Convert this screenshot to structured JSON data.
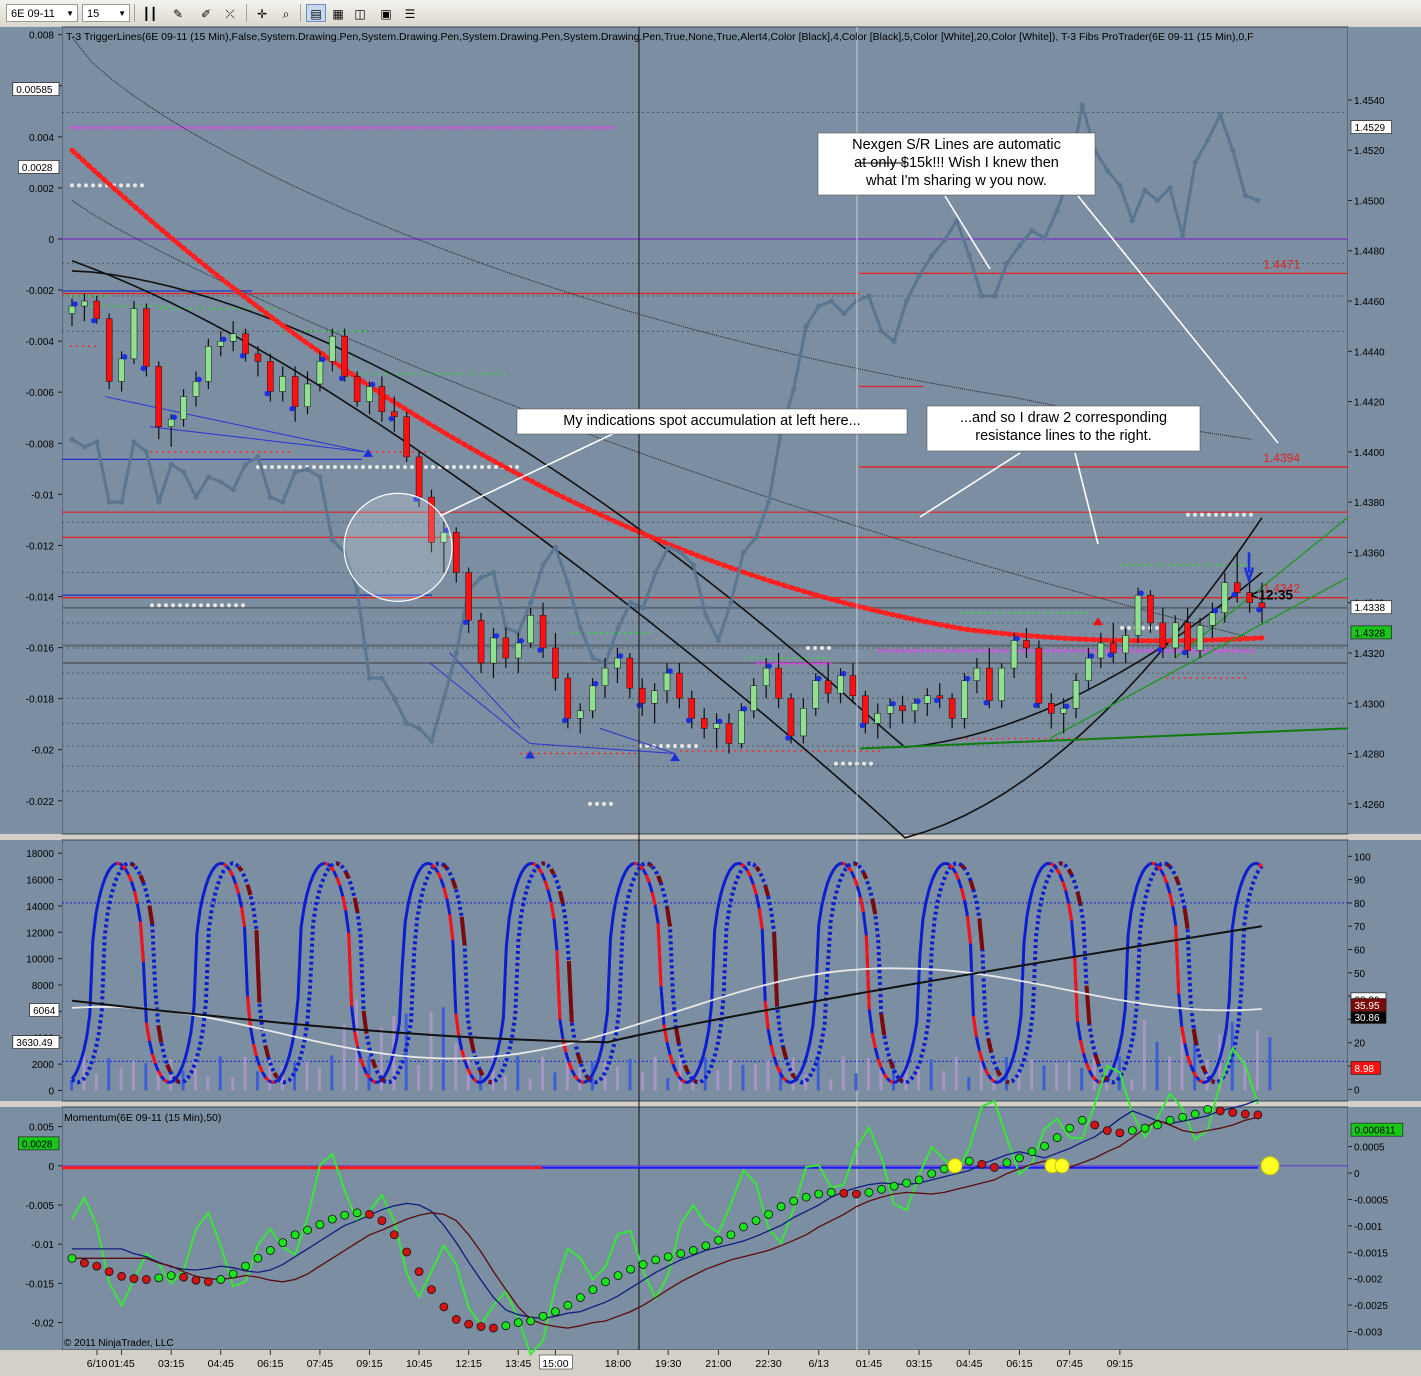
{
  "toolbar": {
    "instrument": "6E 09-11",
    "interval": "15 Min",
    "icons": [
      "bar-style-icon",
      "draw-pen-icon",
      "crosshair-icon",
      "zoom-icon",
      "properties-icon",
      "indicators-icon",
      "strategies-icon",
      "data-box-icon"
    ]
  },
  "colors": {
    "plot_bg": "#7c8ea1",
    "up_bar": "#8fe08f",
    "down_bar": "#ff1010",
    "ma_red": "#ff2020",
    "price_line": "#5a7690",
    "resistance": "#e32020",
    "magenta": "#ff33ff",
    "stoch_blue": "#0b1fd0",
    "stoch_cyan": "#22e6f5",
    "stoch_darkred": "#7b0a0a"
  },
  "chart_data": [
    {
      "panel": "price",
      "type": "candlestick",
      "header": "T-3 TriggerLines(6E 09-11 (15 Min),False,System.Drawing.Pen,System.Drawing.Pen,System.Drawing.Pen,System.Drawing.Pen,True,None,True,Alert4,Color [Black],4,Color [Black],5,Color [White],20,Color [White]), T-3 Fibs ProTrader(6E 09-11 (15 Min),0,F",
      "left_axis": {
        "range": [
          -0.0233,
          0.0083
        ],
        "ticks": [
          0.008,
          0.006,
          0.004,
          0.002,
          0,
          -0.002,
          -0.004,
          -0.006,
          -0.008,
          -0.01,
          -0.012,
          -0.014,
          -0.016,
          -0.018,
          -0.02,
          -0.022
        ],
        "labels": [
          "0.008",
          "0.006",
          "0.004",
          "0.002",
          "0",
          "-0.002",
          "-0.004",
          "-0.006",
          "-0.008",
          "-0.01",
          "-0.012",
          "-0.014",
          "-0.016",
          "-0.018",
          "-0.02",
          "-0.022"
        ]
      },
      "right_axis": {
        "range": [
          1.4248,
          1.4569
        ],
        "ticks": [
          1.454,
          1.452,
          1.45,
          1.448,
          1.446,
          1.444,
          1.442,
          1.44,
          1.438,
          1.436,
          1.434,
          1.432,
          1.43,
          1.428,
          1.426
        ],
        "labels": [
          "1.4540",
          "1.4520",
          "1.4500",
          "1.4480",
          "1.4460",
          "1.4440",
          "1.4420",
          "1.4400",
          "1.4380",
          "1.4360",
          "1.4340",
          "1.4320",
          "1.4300",
          "1.4280",
          "1.4260"
        ]
      },
      "markers_left": [
        {
          "value": 0.00585,
          "label": "0.00585"
        },
        {
          "value": 0.0028,
          "label": "0.0028"
        }
      ],
      "markers_right": [
        {
          "value": 1.4529,
          "label": "1.4529",
          "style": "white"
        },
        {
          "value": 1.4338,
          "label": "1.4338",
          "style": "white"
        },
        {
          "value": 1.4328,
          "label": "1.4328",
          "style": "green"
        }
      ],
      "time_remaining": "<12:35",
      "levels": [
        {
          "value": 1.4471,
          "label": "1.4471",
          "from": 0.62,
          "to": 1.0
        },
        {
          "value": 1.4394,
          "label": "1.4394",
          "from": 0.62,
          "to": 1.0
        },
        {
          "value": 1.4342,
          "label": "1.4342",
          "from": 0.0,
          "to": 1.0
        }
      ],
      "candles": [
        [
          1.4455,
          1.4461,
          1.445,
          1.4458
        ],
        [
          1.4458,
          1.4463,
          1.4452,
          1.446
        ],
        [
          1.446,
          1.4462,
          1.4451,
          1.4453
        ],
        [
          1.4453,
          1.4455,
          1.4425,
          1.4428
        ],
        [
          1.4428,
          1.444,
          1.4424,
          1.4437
        ],
        [
          1.4437,
          1.446,
          1.4435,
          1.4457
        ],
        [
          1.4457,
          1.4459,
          1.443,
          1.4434
        ],
        [
          1.4434,
          1.4436,
          1.4405,
          1.441
        ],
        [
          1.441,
          1.4415,
          1.4402,
          1.4413
        ],
        [
          1.4413,
          1.4425,
          1.441,
          1.4422
        ],
        [
          1.4422,
          1.4432,
          1.4418,
          1.4428
        ],
        [
          1.4428,
          1.4445,
          1.4425,
          1.4442
        ],
        [
          1.4442,
          1.4448,
          1.4438,
          1.4444
        ],
        [
          1.4444,
          1.4452,
          1.444,
          1.4447
        ],
        [
          1.4447,
          1.4449,
          1.4436,
          1.4439
        ],
        [
          1.4439,
          1.4442,
          1.443,
          1.4436
        ],
        [
          1.4436,
          1.4439,
          1.442,
          1.4424
        ],
        [
          1.4424,
          1.4434,
          1.442,
          1.443
        ],
        [
          1.443,
          1.4434,
          1.4412,
          1.4418
        ],
        [
          1.4418,
          1.4432,
          1.4415,
          1.4427
        ],
        [
          1.4427,
          1.444,
          1.4424,
          1.4436
        ],
        [
          1.4436,
          1.4449,
          1.4432,
          1.4446
        ],
        [
          1.4446,
          1.4449,
          1.4428,
          1.443
        ],
        [
          1.443,
          1.4432,
          1.4418,
          1.442
        ],
        [
          1.442,
          1.4428,
          1.4415,
          1.4426
        ],
        [
          1.4426,
          1.443,
          1.4412,
          1.4416
        ],
        [
          1.4416,
          1.4422,
          1.4408,
          1.4414
        ],
        [
          1.4414,
          1.4416,
          1.4396,
          1.4398
        ],
        [
          1.4398,
          1.44,
          1.4378,
          1.4382
        ],
        [
          1.4382,
          1.4385,
          1.436,
          1.4364
        ],
        [
          1.4364,
          1.4372,
          1.4352,
          1.4368
        ],
        [
          1.4368,
          1.437,
          1.4348,
          1.4352
        ],
        [
          1.4352,
          1.4354,
          1.4328,
          1.4333
        ],
        [
          1.4333,
          1.4336,
          1.4312,
          1.4316
        ],
        [
          1.4316,
          1.433,
          1.431,
          1.4326
        ],
        [
          1.4326,
          1.433,
          1.4314,
          1.4318
        ],
        [
          1.4318,
          1.4328,
          1.4312,
          1.4324
        ],
        [
          1.4324,
          1.4338,
          1.4322,
          1.4335
        ],
        [
          1.4335,
          1.434,
          1.4318,
          1.4322
        ],
        [
          1.4322,
          1.4328,
          1.4305,
          1.431
        ],
        [
          1.431,
          1.4312,
          1.429,
          1.4294
        ],
        [
          1.4294,
          1.43,
          1.4288,
          1.4297
        ],
        [
          1.4297,
          1.431,
          1.4294,
          1.4307
        ],
        [
          1.4307,
          1.4318,
          1.4302,
          1.4314
        ],
        [
          1.4314,
          1.4322,
          1.4308,
          1.4318
        ],
        [
          1.4318,
          1.432,
          1.4302,
          1.4306
        ],
        [
          1.4306,
          1.431,
          1.4295,
          1.43
        ],
        [
          1.43,
          1.4308,
          1.4292,
          1.4305
        ],
        [
          1.4305,
          1.4316,
          1.43,
          1.4312
        ],
        [
          1.4312,
          1.4316,
          1.4298,
          1.4302
        ],
        [
          1.4302,
          1.4305,
          1.429,
          1.4294
        ],
        [
          1.4294,
          1.4298,
          1.4286,
          1.429
        ],
        [
          1.429,
          1.4296,
          1.4282,
          1.4292
        ],
        [
          1.4292,
          1.4296,
          1.428,
          1.4284
        ],
        [
          1.4284,
          1.43,
          1.4282,
          1.4297
        ],
        [
          1.4297,
          1.431,
          1.4294,
          1.4307
        ],
        [
          1.4307,
          1.4318,
          1.4302,
          1.4314
        ],
        [
          1.4314,
          1.432,
          1.4298,
          1.4302
        ],
        [
          1.4302,
          1.4304,
          1.4284,
          1.4287
        ],
        [
          1.4287,
          1.4302,
          1.4284,
          1.4298
        ],
        [
          1.4298,
          1.4312,
          1.4295,
          1.4309
        ],
        [
          1.4309,
          1.4316,
          1.43,
          1.4304
        ],
        [
          1.4304,
          1.4314,
          1.43,
          1.4311
        ],
        [
          1.4311,
          1.4316,
          1.43,
          1.4303
        ],
        [
          1.4303,
          1.4305,
          1.4288,
          1.4292
        ],
        [
          1.4292,
          1.43,
          1.4286,
          1.4296
        ],
        [
          1.4296,
          1.4302,
          1.429,
          1.4299
        ],
        [
          1.4299,
          1.4303,
          1.4292,
          1.4297
        ],
        [
          1.4297,
          1.4302,
          1.4292,
          1.43
        ],
        [
          1.43,
          1.4306,
          1.4295,
          1.4303
        ],
        [
          1.4303,
          1.4308,
          1.4298,
          1.4302
        ],
        [
          1.4302,
          1.4304,
          1.429,
          1.4294
        ],
        [
          1.4294,
          1.4312,
          1.429,
          1.4309
        ],
        [
          1.4309,
          1.4318,
          1.4304,
          1.4314
        ],
        [
          1.4314,
          1.4322,
          1.4298,
          1.4301
        ],
        [
          1.4301,
          1.4316,
          1.4298,
          1.4314
        ],
        [
          1.4314,
          1.4328,
          1.431,
          1.4325
        ],
        [
          1.4325,
          1.433,
          1.4318,
          1.4322
        ],
        [
          1.4322,
          1.4325,
          1.4298,
          1.43
        ],
        [
          1.43,
          1.4304,
          1.429,
          1.4296
        ],
        [
          1.4296,
          1.4302,
          1.4288,
          1.4298
        ],
        [
          1.4298,
          1.4312,
          1.4294,
          1.4309
        ],
        [
          1.4309,
          1.4322,
          1.4305,
          1.4318
        ],
        [
          1.4318,
          1.4328,
          1.4314,
          1.4324
        ],
        [
          1.4324,
          1.4332,
          1.4316,
          1.432
        ],
        [
          1.432,
          1.433,
          1.4316,
          1.4327
        ],
        [
          1.4327,
          1.4346,
          1.4324,
          1.4343
        ],
        [
          1.4343,
          1.4345,
          1.4328,
          1.4332
        ],
        [
          1.4332,
          1.4338,
          1.4318,
          1.4322
        ],
        [
          1.4322,
          1.4335,
          1.4318,
          1.4332
        ],
        [
          1.4332,
          1.4338,
          1.4318,
          1.4321
        ],
        [
          1.4321,
          1.4334,
          1.4318,
          1.4331
        ],
        [
          1.4331,
          1.434,
          1.4326,
          1.4336
        ],
        [
          1.4336,
          1.4352,
          1.4332,
          1.4348
        ],
        [
          1.4348,
          1.436,
          1.434,
          1.4344
        ],
        [
          1.4344,
          1.435,
          1.4336,
          1.434
        ],
        [
          1.434,
          1.4348,
          1.4332,
          1.4338
        ]
      ],
      "price_line": [
        1.4405,
        1.4402,
        1.4404,
        1.438,
        1.438,
        1.4404,
        1.44,
        1.438,
        1.4395,
        1.4392,
        1.4382,
        1.439,
        1.4388,
        1.4385,
        1.4395,
        1.4398,
        1.4382,
        1.438,
        1.4392,
        1.4393,
        1.439,
        1.4365,
        1.436,
        1.4345,
        1.431,
        1.431,
        1.4302,
        1.4292,
        1.429,
        1.4285,
        1.4302,
        1.432,
        1.4345,
        1.435,
        1.4352,
        1.433,
        1.4328,
        1.434,
        1.4355,
        1.4362,
        1.4348,
        1.433,
        1.4318,
        1.4316,
        1.433,
        1.434,
        1.4338,
        1.4352,
        1.4362,
        1.436,
        1.4355,
        1.4335,
        1.4325,
        1.434,
        1.436,
        1.4366,
        1.438,
        1.4408,
        1.4425,
        1.445,
        1.4458,
        1.446,
        1.4455,
        1.446,
        1.4462,
        1.4448,
        1.4444,
        1.446,
        1.447,
        1.4478,
        1.4484,
        1.4492,
        1.4478,
        1.4462,
        1.4462,
        1.4475,
        1.4482,
        1.4488,
        1.4485,
        1.4496,
        1.451,
        1.4538,
        1.452,
        1.4512,
        1.4506,
        1.4492,
        1.4504,
        1.45,
        1.4505,
        1.4486,
        1.4515,
        1.4524,
        1.4534,
        1.452,
        1.4502,
        1.45
      ],
      "x_labels": [
        "6/10",
        "01:45",
        "03:15",
        "04:45",
        "06:15",
        "07:45",
        "09:15",
        "10:45",
        "12:15",
        "13:45",
        "15:00",
        "18:00",
        "19:30",
        "21:00",
        "22:30",
        "6/13",
        "01:45",
        "03:15",
        "04:45",
        "06:15",
        "07:45",
        "09:15"
      ],
      "x_label_bars": [
        0,
        4,
        8,
        12,
        16,
        20,
        24,
        28,
        32,
        36,
        39,
        44,
        48,
        52,
        56,
        60,
        64,
        68,
        72,
        76,
        80,
        84
      ],
      "annotations": [
        {
          "text": "Nexgen S/R Lines are automatic at only $15k!!! Wish I knew then what I'm sharing w you now.",
          "lines": [
            "Nexgen S/R Lines are automatic",
            "at only $15k!!! Wish I knew then",
            "what I'm sharing w you now."
          ],
          "strike_phrase": "only $15k"
        },
        {
          "text": "My indications spot accumulation at left here...",
          "lines": [
            "My indications spot accumulation at left here..."
          ]
        },
        {
          "text": "...and so I draw 2 corresponding resistance lines to the right.",
          "lines": [
            "...and so I draw 2 corresponding",
            "resistance lines to the right."
          ]
        }
      ]
    },
    {
      "panel": "oscillator",
      "type": "line",
      "left_axis": {
        "range": [
          -800,
          19000
        ],
        "ticks": [
          18000,
          16000,
          14000,
          12000,
          10000,
          8000,
          6000,
          4000,
          2000,
          0
        ],
        "labels": [
          "18000",
          "16000",
          "14000",
          "12000",
          "10000",
          "8000",
          "6000",
          "4000",
          "2000",
          "0"
        ]
      },
      "right_axis": {
        "range": [
          -5,
          107
        ],
        "ticks": [
          100,
          90,
          80,
          70,
          60,
          50,
          40,
          30,
          20,
          10,
          0
        ],
        "labels": [
          "100",
          "90",
          "80",
          "70",
          "60",
          "50",
          "40",
          "30",
          "20",
          "10",
          "0"
        ]
      },
      "markers_left": [
        {
          "value": 6064,
          "label": "6064"
        },
        {
          "value": 3630.49,
          "label": "3630.49"
        }
      ],
      "markers_right": [
        {
          "value": 38.39,
          "label": "38.39",
          "style": "white"
        },
        {
          "value": 30.86,
          "label": "30.86",
          "style": "black"
        },
        {
          "value": 35.95,
          "label": "35.95",
          "style": "darkred"
        },
        {
          "value": 8.98,
          "label": "8.98",
          "style": "red"
        }
      ],
      "guide_levels": [
        {
          "value": 80,
          "scale": "right"
        },
        {
          "value": 12,
          "scale": "right"
        }
      ]
    },
    {
      "panel": "momentum",
      "type": "line",
      "header": "Momentum(6E 09-11 (15 Min),50)",
      "left_axis": {
        "range": [
          -0.0235,
          0.0075
        ],
        "ticks": [
          0.005,
          0,
          -0.005,
          -0.01,
          -0.015,
          -0.02
        ],
        "labels": [
          "0.005",
          "0",
          "-0.005",
          "-0.01",
          "-0.015",
          "-0.02"
        ]
      },
      "right_axis": {
        "range": [
          -0.00335,
          0.00125
        ],
        "ticks": [
          0.0005,
          0,
          -0.0005,
          -0.001,
          -0.0015,
          -0.002,
          -0.0025,
          -0.003
        ],
        "labels": [
          "0.0005",
          "0",
          "-0.0005",
          "-0.001",
          "-0.0015",
          "-0.002",
          "-0.0025",
          "-0.003"
        ]
      },
      "markers_left": [
        {
          "value": 0.0028,
          "label": "0.0028"
        }
      ],
      "markers_right": [
        {
          "value": 0.000811,
          "label": "0.000811",
          "style": "green"
        }
      ],
      "momentum_values": [
        -0.0118,
        -0.0124,
        -0.0128,
        -0.0135,
        -0.0141,
        -0.0144,
        -0.0145,
        -0.0143,
        -0.014,
        -0.0142,
        -0.0146,
        -0.0148,
        -0.0145,
        -0.0138,
        -0.0128,
        -0.0118,
        -0.0108,
        -0.0098,
        -0.0088,
        -0.0082,
        -0.0075,
        -0.0068,
        -0.0063,
        -0.006,
        -0.0062,
        -0.007,
        -0.0088,
        -0.011,
        -0.0135,
        -0.0158,
        -0.018,
        -0.0196,
        -0.0202,
        -0.0205,
        -0.0207,
        -0.0204,
        -0.02,
        -0.0198,
        -0.0192,
        -0.0186,
        -0.0178,
        -0.0168,
        -0.0158,
        -0.0148,
        -0.014,
        -0.0132,
        -0.0126,
        -0.012,
        -0.0116,
        -0.0112,
        -0.0108,
        -0.0102,
        -0.0095,
        -0.0088,
        -0.0078,
        -0.007,
        -0.0062,
        -0.0052,
        -0.0045,
        -0.004,
        -0.0036,
        -0.0034,
        -0.0035,
        -0.0036,
        -0.0034,
        -0.003,
        -0.0026,
        -0.0022,
        -0.0018,
        -0.001,
        -0.0004,
        0.0002,
        0.0006,
        0.0002,
        -0.0002,
        0.0004,
        0.001,
        0.0018,
        0.0025,
        0.0036,
        0.0048,
        0.0058,
        0.0052,
        0.0045,
        0.0042,
        0.0045,
        0.0048,
        0.0052,
        0.0058,
        0.0062,
        0.0066,
        0.0072,
        0.007,
        0.0068,
        0.0066,
        0.0065
      ]
    }
  ]
}
